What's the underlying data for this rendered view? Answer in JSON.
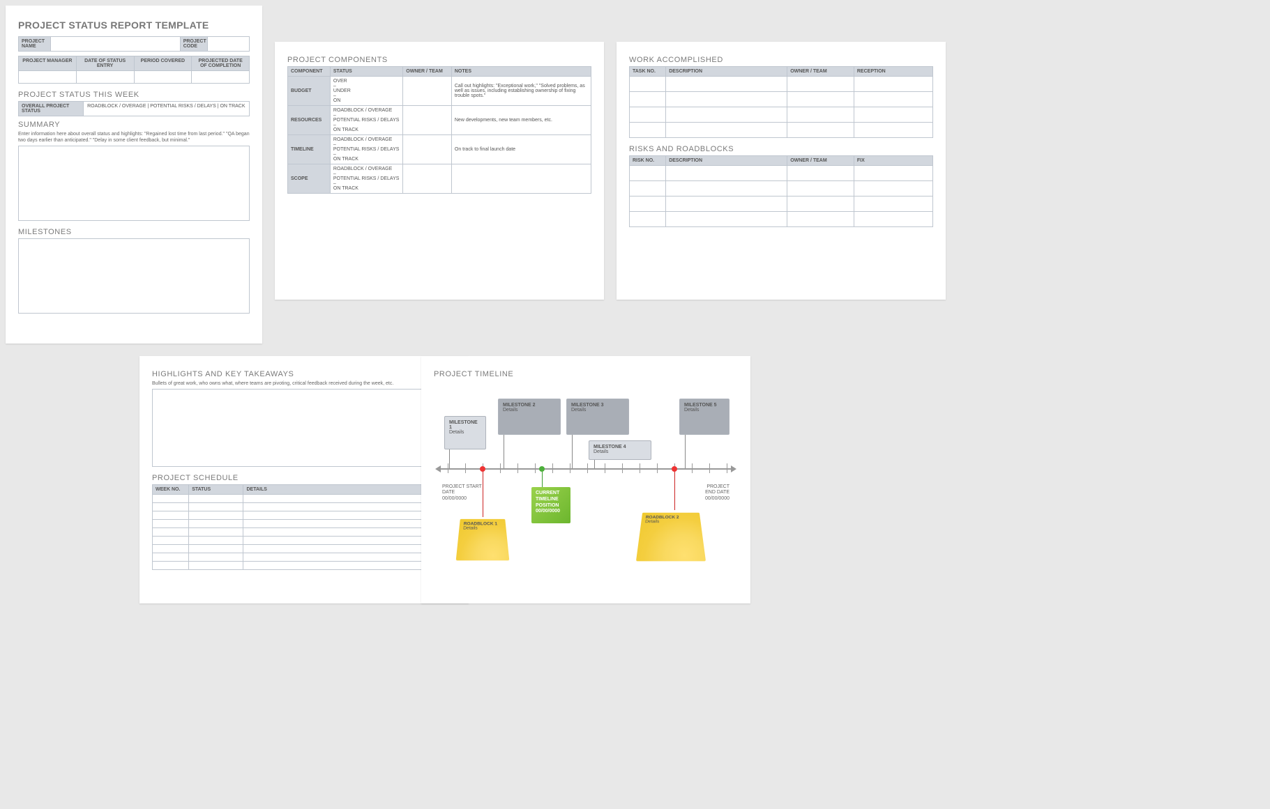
{
  "page1": {
    "title": "PROJECT STATUS REPORT TEMPLATE",
    "header_labels": {
      "project_name": "PROJECT NAME",
      "project_code": "PROJECT CODE",
      "project_manager": "PROJECT MANAGER",
      "date_status_entry": "DATE OF STATUS ENTRY",
      "period_covered": "PERIOD COVERED",
      "projected_completion": "PROJECTED DATE OF COMPLETION"
    },
    "status_section": "PROJECT STATUS THIS WEEK",
    "overall_label": "OVERALL PROJECT STATUS",
    "overall_legend": "ROADBLOCK / OVERAGE   |   POTENTIAL RISKS / DELAYS   |   ON TRACK",
    "summary_label": "SUMMARY",
    "summary_hint": "Enter information here about overall status and highlights: \"Regained lost time from last period.\" \"QA began two days earlier than anticipated.\" \"Delay in some client feedback, but minimal.\"",
    "milestones_label": "MILESTONES"
  },
  "page2": {
    "title": "PROJECT COMPONENTS",
    "cols": [
      "COMPONENT",
      "STATUS",
      "OWNER / TEAM",
      "NOTES"
    ],
    "rows": [
      {
        "comp": "BUDGET",
        "status": "OVER\n–\nUNDER\n–\nON",
        "notes": "Call out highlights: \"Exceptional work,\" \"Solved problems, as well as issues, including establishing ownership of fixing trouble spots.\""
      },
      {
        "comp": "RESOURCES",
        "status": "ROADBLOCK / OVERAGE\n–\nPOTENTIAL RISKS / DELAYS\n–\nON TRACK",
        "notes": "New developments, new team members, etc."
      },
      {
        "comp": "TIMELINE",
        "status": "ROADBLOCK / OVERAGE\n–\nPOTENTIAL RISKS / DELAYS\n–\nON TRACK",
        "notes": "On track to final launch date"
      },
      {
        "comp": "SCOPE",
        "status": "ROADBLOCK / OVERAGE\n–\nPOTENTIAL RISKS / DELAYS\n–\nON TRACK",
        "notes": ""
      }
    ]
  },
  "page3": {
    "work_title": "WORK ACCOMPLISHED",
    "work_cols": [
      "TASK NO.",
      "DESCRIPTION",
      "OWNER / TEAM",
      "RECEPTION"
    ],
    "risks_title": "RISKS AND ROADBLOCKS",
    "risks_cols": [
      "RISK NO.",
      "DESCRIPTION",
      "OWNER / TEAM",
      "FIX"
    ]
  },
  "page4": {
    "highlights_title": "HIGHLIGHTS AND KEY TAKEAWAYS",
    "highlights_hint": "Bullets of great work, who owns what, where teams are pivoting, critical feedback received during the week, etc.",
    "schedule_title": "PROJECT SCHEDULE",
    "schedule_cols": [
      "WEEK NO.",
      "STATUS",
      "DETAILS"
    ]
  },
  "page5": {
    "title": "PROJECT TIMELINE",
    "start": {
      "l1": "PROJECT START",
      "l2": "DATE",
      "l3": "00/00/0000"
    },
    "end": {
      "l1": "PROJECT",
      "l2": "END DATE",
      "l3": "00/00/0000"
    },
    "ms": [
      {
        "t": "MILESTONE 1",
        "d": "Details"
      },
      {
        "t": "MILESTONE 2",
        "d": "Details"
      },
      {
        "t": "MILESTONE 3",
        "d": "Details"
      },
      {
        "t": "MILESTONE 4",
        "d": "Details"
      },
      {
        "t": "MILESTONE 5",
        "d": "Details"
      }
    ],
    "rb": [
      {
        "t": "ROADBLOCK 1",
        "d": "Details"
      },
      {
        "t": "ROADBLOCK 2",
        "d": "Details"
      }
    ],
    "cur": {
      "l1": "CURRENT",
      "l2": "TIMELINE",
      "l3": "POSITION",
      "l4": "00/00/0000"
    }
  }
}
